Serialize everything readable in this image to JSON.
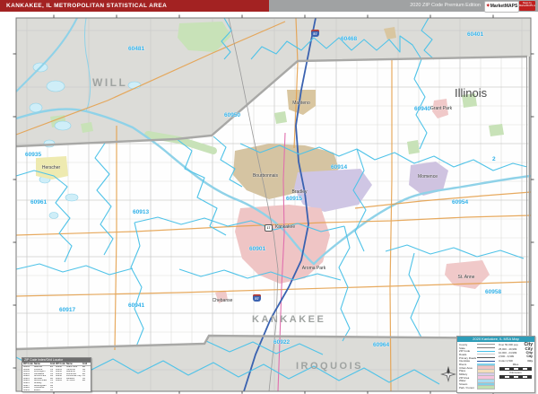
{
  "header": {
    "title": "KANKAKEE, IL METROPOLITAN STATISTICAL AREA",
    "edition": "2020 ZIP Code Premium Edition",
    "logo": {
      "mark": "✷",
      "name": "MarketMAPS",
      "badge": "Maps by MarketMAPS.com"
    }
  },
  "map": {
    "state_label": "Illinois",
    "grid_ref": "2",
    "county_labels": [
      "WILL",
      "KANKAKEE",
      "IROQUOIS"
    ],
    "zip_labels": [
      "60481",
      "60401",
      "60468",
      "60950",
      "60940",
      "60935",
      "60914",
      "60954",
      "60961",
      "60913",
      "60915",
      "60901",
      "60917",
      "60941",
      "60922",
      "60964",
      "60958"
    ],
    "city_labels": [
      "Manteno",
      "Bourbonnais",
      "Bradley",
      "Kankakee",
      "Aroma Park",
      "Momence",
      "St. Anne",
      "Herscher",
      "Grant Park",
      "Chebanse"
    ],
    "shields": {
      "interstate": "57",
      "state_route": "17"
    }
  },
  "index_table": {
    "title": "ZIP Code Index/Grid Locator",
    "headers": [
      "ZIP Code",
      "Name",
      "Grid",
      "ZIP Code",
      "Name",
      "Grid"
    ],
    "rows": [
      [
        "60401",
        "Beecher",
        "E1",
        "60940",
        "Grant Park",
        "E2"
      ],
      [
        "60468",
        "Peotone",
        "C1",
        "60941",
        "Herscher",
        "A4"
      ],
      [
        "60481",
        "Wilmington",
        "A1",
        "60950",
        "Manteno",
        "C2"
      ],
      [
        "60901",
        "Kankakee",
        "C4",
        "60954",
        "Momence",
        "E3"
      ],
      [
        "60910",
        "Aroma Park",
        "D4",
        "60958",
        "Pembroke Twp",
        "F4"
      ],
      [
        "60913",
        "Bonfield",
        "B3",
        "60961",
        "Reddick",
        "A3"
      ],
      [
        "60914",
        "Bourbonnais",
        "C3",
        "60964",
        "St. Anne",
        "E4"
      ],
      [
        "60915",
        "Bradley",
        "C3",
        "",
        "",
        ""
      ],
      [
        "60917",
        "Buckingham",
        "A4",
        "",
        "",
        ""
      ],
      [
        "60922",
        "Chebanse",
        "C5",
        "",
        "",
        ""
      ],
      [
        "60935",
        "Essex",
        "A2",
        "",
        "",
        ""
      ]
    ]
  },
  "legend": {
    "title": "2020 Kankakee, IL MSA Map",
    "line_items": [
      {
        "label": "County",
        "color": "#9a9a9a"
      },
      {
        "label": "State",
        "color": "#7a7a7a"
      },
      {
        "label": "ZIP Code",
        "color": "#45c0e8"
      },
      {
        "label": "Roads",
        "color": "#c9c9c9"
      },
      {
        "label": "Primary Roads",
        "color": "#555555"
      },
      {
        "label": "Interstate",
        "color": "#2b55a3"
      },
      {
        "label": "Rivers",
        "color": "#7fd0ea"
      }
    ],
    "area_items": [
      {
        "label": "Urban Area",
        "color": "#f0c3c3"
      },
      {
        "label": "Place",
        "color": "#f3ddba"
      },
      {
        "label": "Military",
        "color": "#d9cdec"
      },
      {
        "label": "ZIP Area",
        "color": "#f6c3dd"
      },
      {
        "label": "Water",
        "color": "#aadcf0"
      },
      {
        "label": "Stream",
        "color": "#7fd0ea"
      },
      {
        "label": "Park / Forest",
        "color": "#bfe0b0"
      }
    ],
    "pop_items": [
      {
        "label": "Over 50,000 pop.",
        "sample": "City"
      },
      {
        "label": "25,000 - 49,999",
        "sample": "City"
      },
      {
        "label": "10,000 - 24,999",
        "sample": "City"
      },
      {
        "label": "2,500 - 9,999",
        "sample": "City"
      },
      {
        "label": "Under 2,500",
        "sample": "City"
      }
    ],
    "scale_miles": "Miles",
    "scale_km": "Kilometers"
  },
  "colors": {
    "header_red": "#a32222",
    "header_gray": "#a0a2a3",
    "zip_label": "#2fb0e8",
    "zip_line": "#4fc3e8",
    "county_line": "#a8a8a6",
    "outside_fill": "#dcdcd8",
    "river": "#8fd2e8",
    "interstate": "#3a62b0",
    "primary_road": "#e5a14e",
    "legend_header": "#2f9db8"
  }
}
